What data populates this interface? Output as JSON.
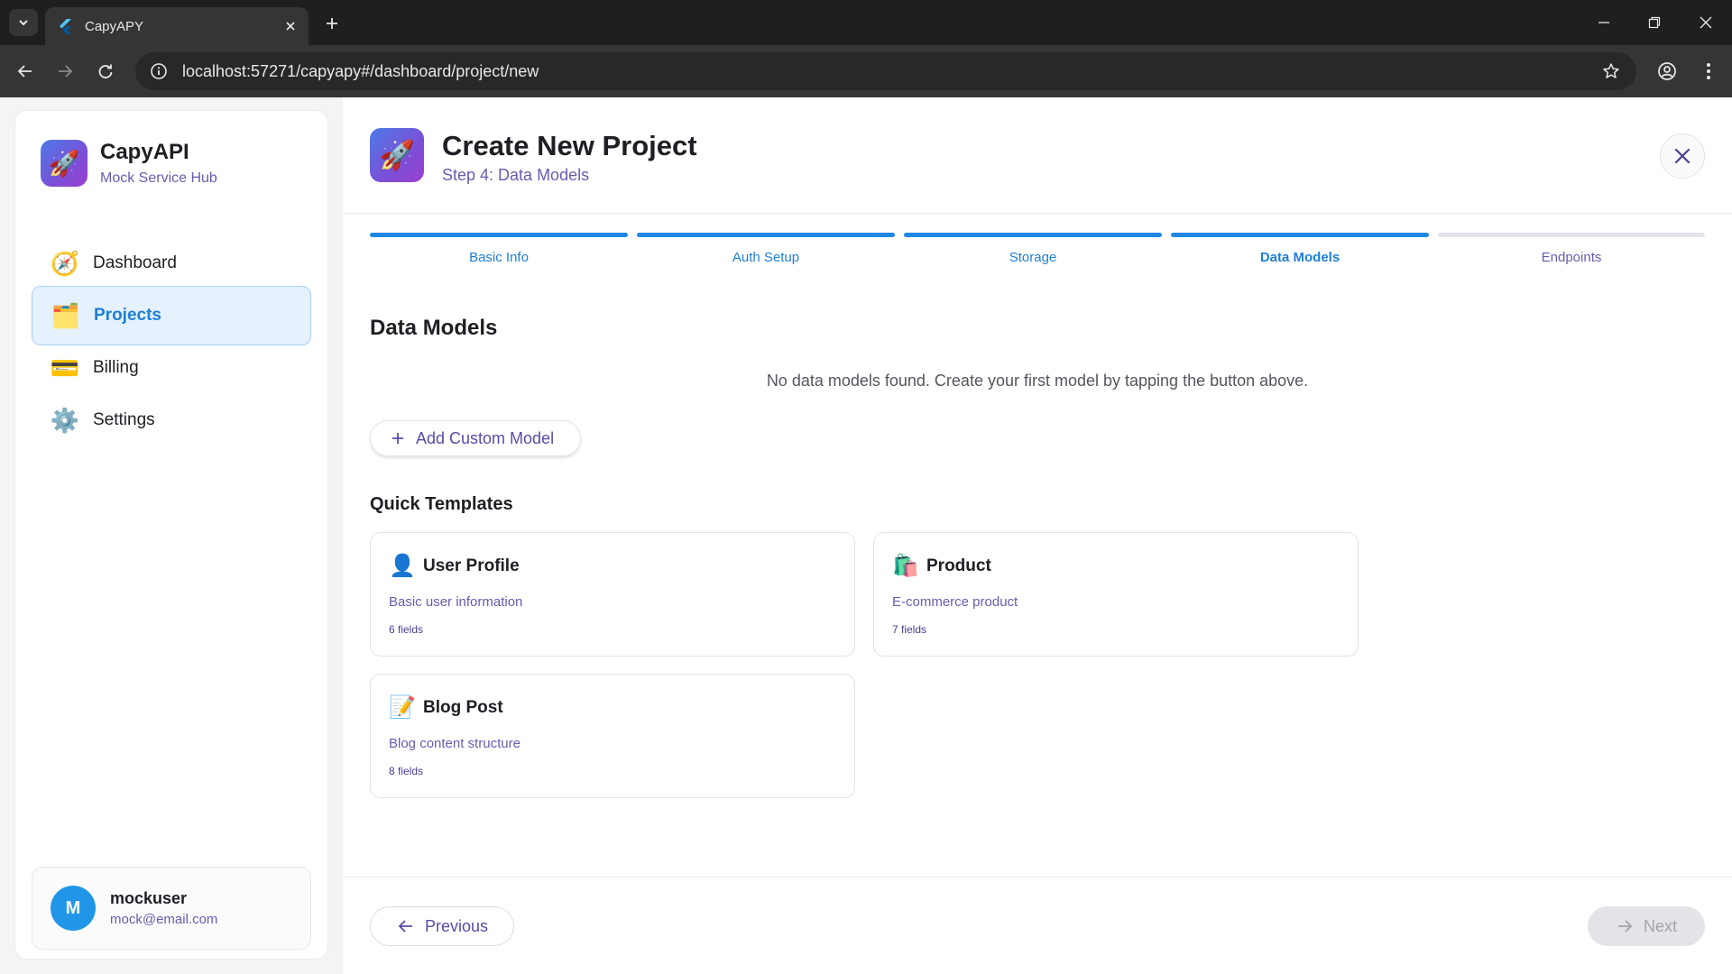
{
  "browser": {
    "tab_title": "CapyAPY",
    "url": "localhost:57271/capyapy#/dashboard/project/new"
  },
  "sidebar": {
    "brand_name": "CapyAPI",
    "brand_sub": "Mock Service Hub",
    "items": [
      {
        "label": "Dashboard",
        "icon": "compass-icon",
        "emoji": "🧭"
      },
      {
        "label": "Projects",
        "icon": "folder-icon",
        "emoji": "🗂️",
        "active": true
      },
      {
        "label": "Billing",
        "icon": "credit-card-icon",
        "emoji": "💳"
      },
      {
        "label": "Settings",
        "icon": "gear-icon",
        "emoji": "⚙️"
      }
    ],
    "user": {
      "initial": "M",
      "name": "mockuser",
      "email": "mock@email.com"
    }
  },
  "header": {
    "title": "Create New Project",
    "subtitle": "Step 4: Data Models",
    "logo_emoji": "🚀"
  },
  "steps": [
    {
      "label": "Basic Info",
      "done": true
    },
    {
      "label": "Auth Setup",
      "done": true
    },
    {
      "label": "Storage",
      "done": true
    },
    {
      "label": "Data Models",
      "done": true,
      "current": true
    },
    {
      "label": "Endpoints",
      "done": false
    }
  ],
  "main": {
    "section_title": "Data Models",
    "empty_message": "No data models found. Create your first model by tapping the button above.",
    "add_button": "Add Custom Model",
    "quick_templates_title": "Quick Templates",
    "templates": [
      {
        "name": "User Profile",
        "description": "Basic user information",
        "fields": "6 fields",
        "emoji": "👤"
      },
      {
        "name": "Product",
        "description": "E-commerce product",
        "fields": "7 fields",
        "emoji": "🛍️"
      },
      {
        "name": "Blog Post",
        "description": "Blog content structure",
        "fields": "8 fields",
        "emoji": "📝"
      }
    ]
  },
  "footer": {
    "previous_label": "Previous",
    "next_label": "Next"
  },
  "colors": {
    "accent": "#1e88e5",
    "purple_text": "#6a5bb0",
    "active_nav_bg": "#e5f1fd"
  }
}
